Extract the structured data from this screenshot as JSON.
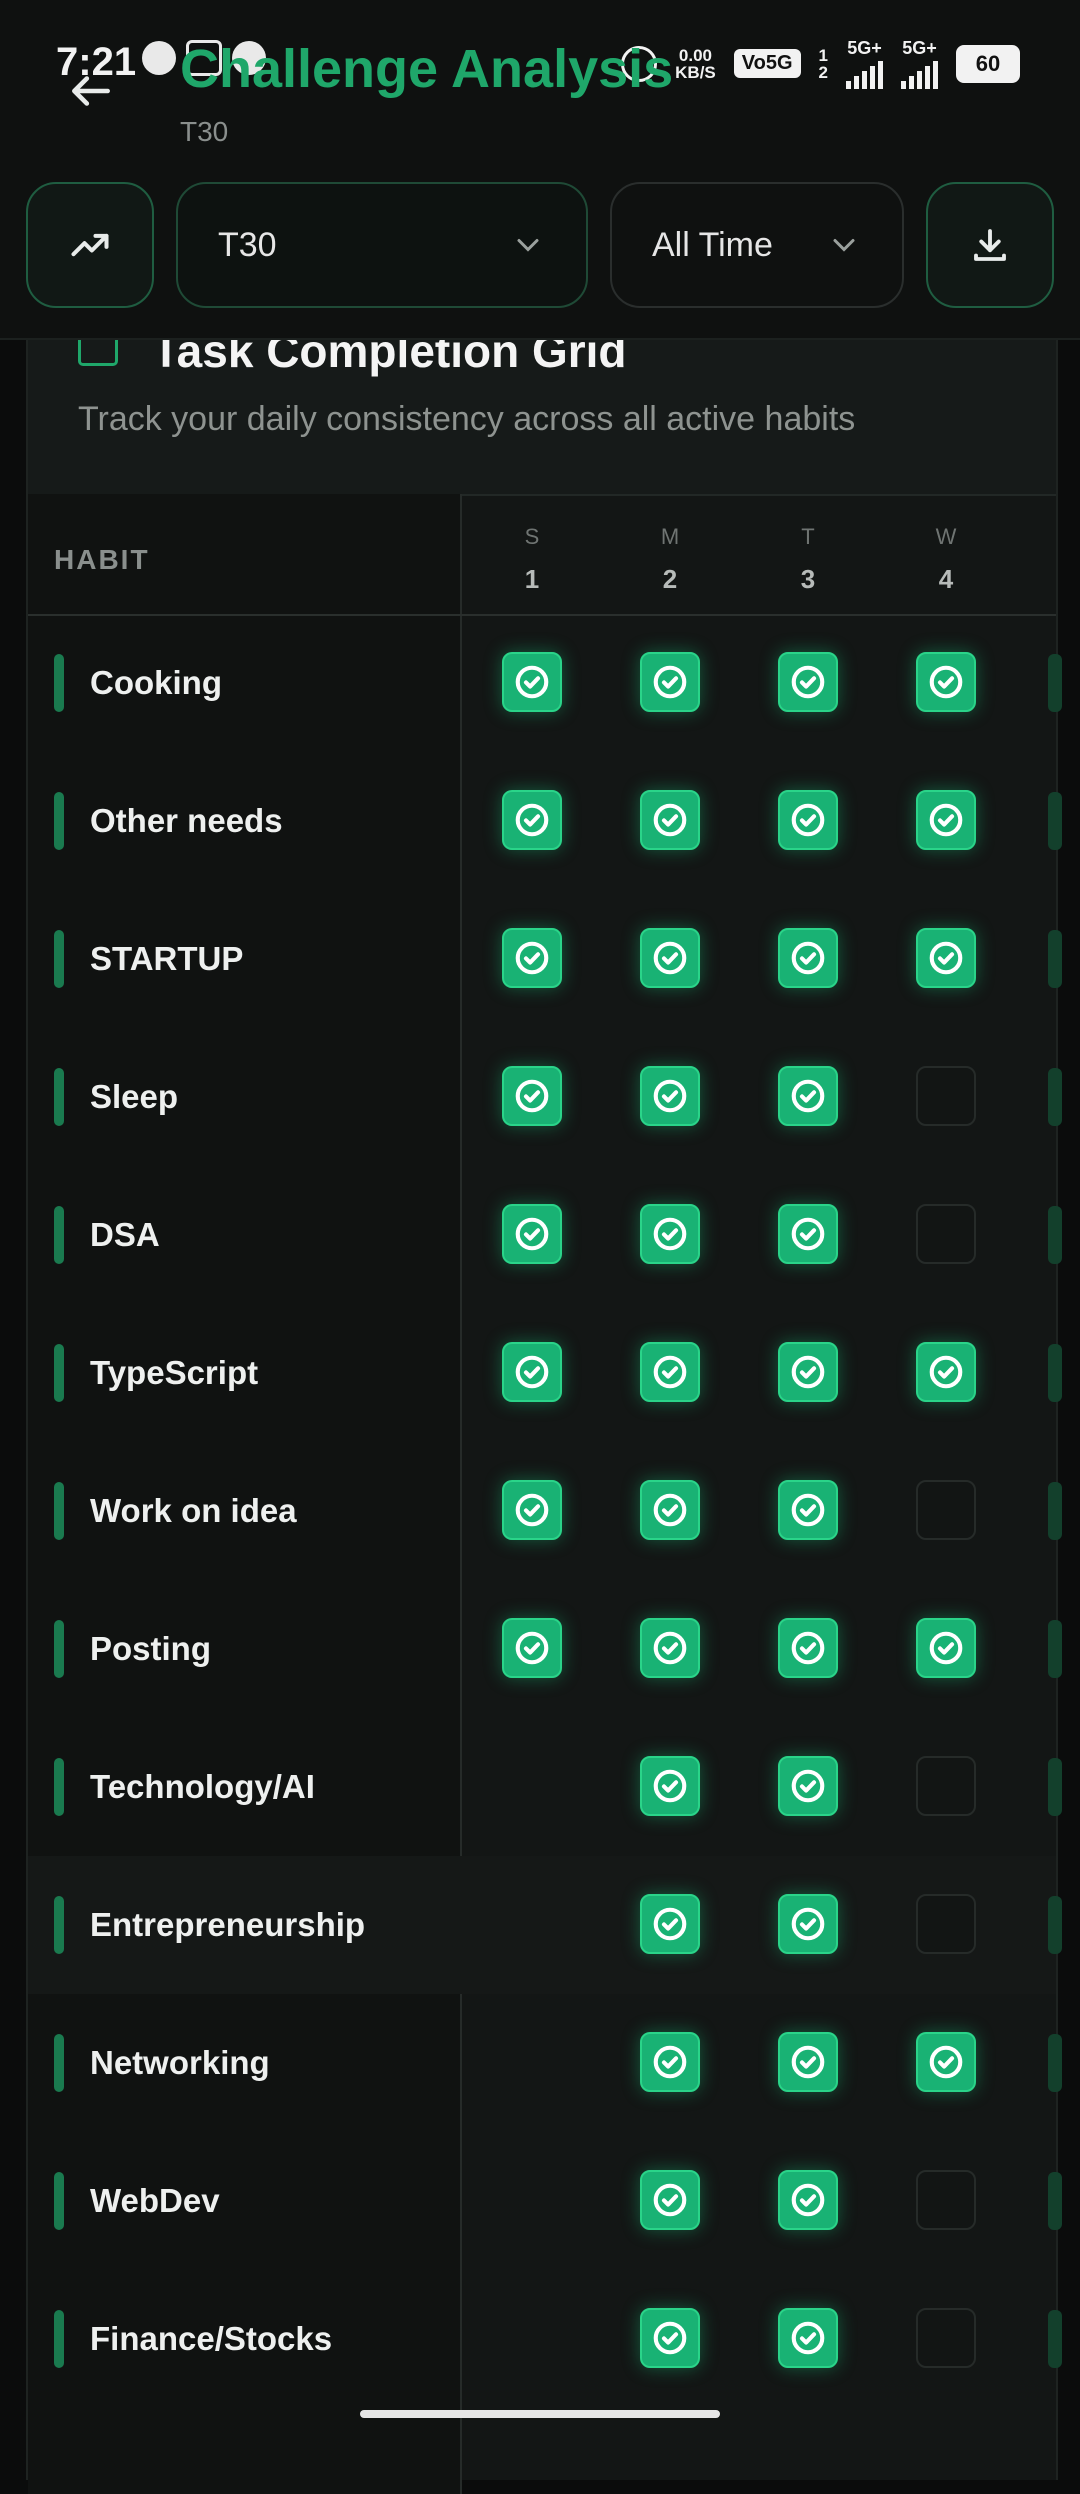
{
  "status": {
    "time": "7:21",
    "net_speed_top": "0.00",
    "net_speed_bottom": "KB/S",
    "volte": "Vo5G",
    "sim_top": "1",
    "sim_bottom": "2",
    "network1": "5G+",
    "network2": "5G+",
    "battery": "60"
  },
  "header": {
    "title": "Challenge Analysis",
    "subtitle": "T30"
  },
  "controls": {
    "challenge_value": "T30",
    "range_value": "All Time"
  },
  "card": {
    "title": "Task Completion Grid",
    "description": "Track your daily consistency across all active habits"
  },
  "grid": {
    "habit_header": "HABIT",
    "days": [
      {
        "letter": "S",
        "num": "1"
      },
      {
        "letter": "M",
        "num": "2"
      },
      {
        "letter": "T",
        "num": "3"
      },
      {
        "letter": "W",
        "num": "4"
      }
    ],
    "rows": [
      {
        "name": "Cooking",
        "cells": [
          "done",
          "done",
          "done",
          "done"
        ]
      },
      {
        "name": "Other needs",
        "cells": [
          "done",
          "done",
          "done",
          "done"
        ]
      },
      {
        "name": "STARTUP",
        "cells": [
          "done",
          "done",
          "done",
          "done"
        ]
      },
      {
        "name": "Sleep",
        "cells": [
          "done",
          "done",
          "done",
          "empty"
        ]
      },
      {
        "name": "DSA",
        "cells": [
          "done",
          "done",
          "done",
          "empty"
        ]
      },
      {
        "name": "TypeScript",
        "cells": [
          "done",
          "done",
          "done",
          "done"
        ]
      },
      {
        "name": "Work on idea",
        "cells": [
          "done",
          "done",
          "done",
          "empty"
        ]
      },
      {
        "name": "Posting",
        "cells": [
          "done",
          "done",
          "done",
          "done"
        ]
      },
      {
        "name": "Technology/AI",
        "cells": [
          "none",
          "done",
          "done",
          "empty"
        ]
      },
      {
        "name": "Entrepreneurship",
        "cells": [
          "none",
          "done",
          "done",
          "empty"
        ]
      },
      {
        "name": "Networking",
        "cells": [
          "none",
          "done",
          "done",
          "done"
        ]
      },
      {
        "name": "WebDev",
        "cells": [
          "none",
          "done",
          "done",
          "empty"
        ]
      },
      {
        "name": "Finance/Stocks",
        "cells": [
          "none",
          "done",
          "done",
          "empty"
        ]
      }
    ]
  }
}
